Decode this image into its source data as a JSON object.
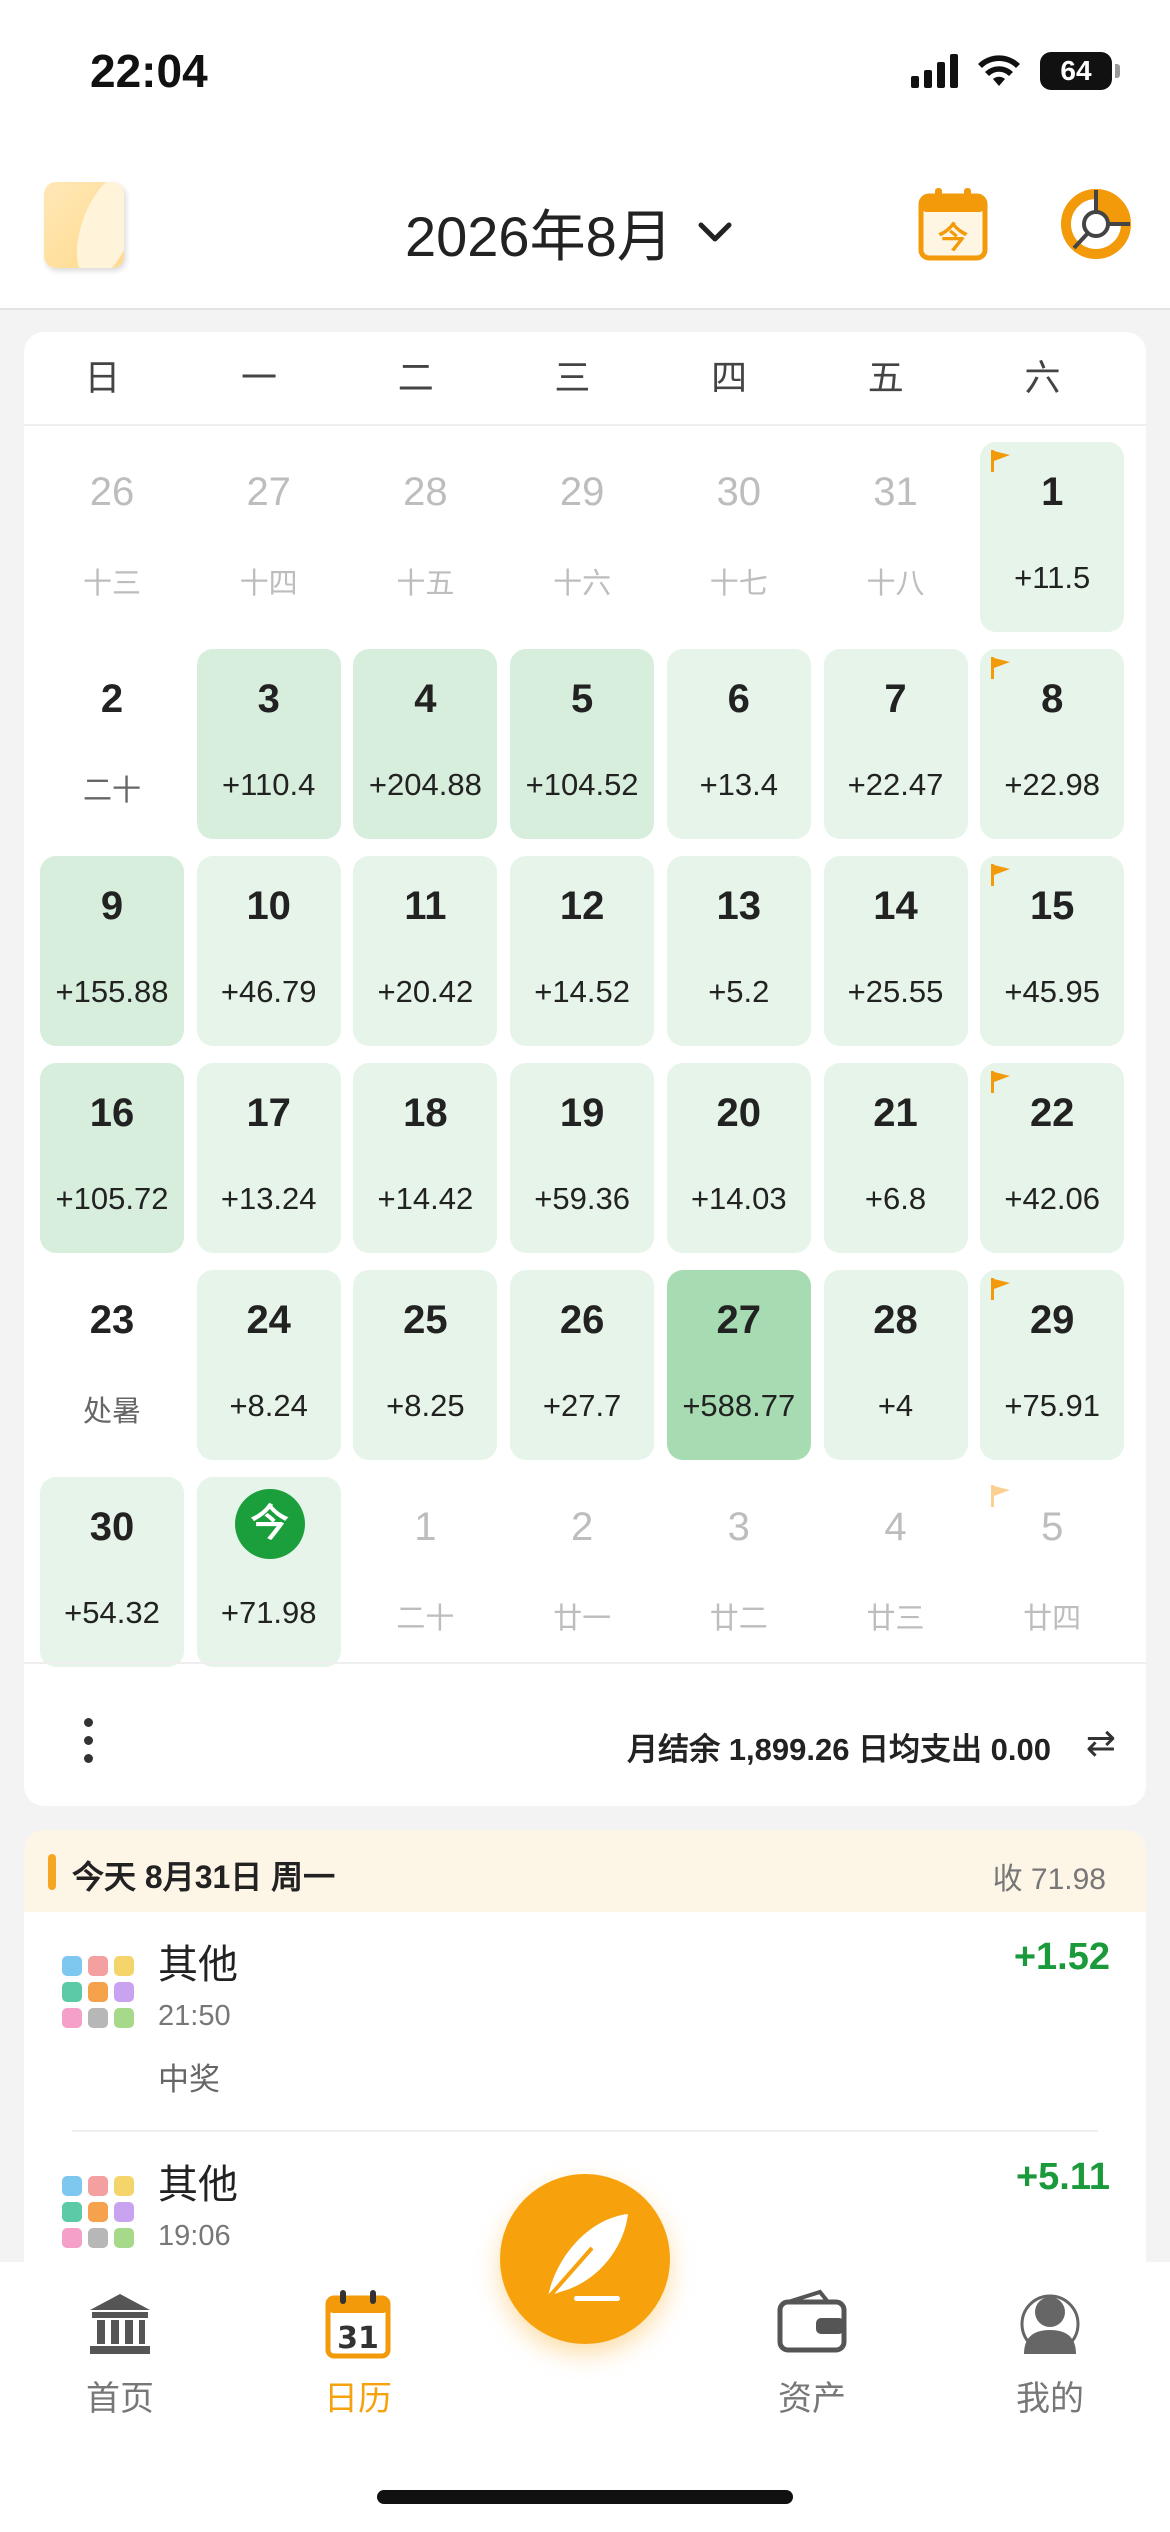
{
  "status": {
    "time": "22:04",
    "battery": "64"
  },
  "header": {
    "month_title": "2026年8月",
    "today_glyph": "今"
  },
  "weekdays": [
    "日",
    "一",
    "二",
    "三",
    "四",
    "五",
    "六"
  ],
  "calendar": [
    {
      "day": "26",
      "sub": "十三",
      "style": "muted",
      "sub_type": "lunar"
    },
    {
      "day": "27",
      "sub": "十四",
      "style": "muted",
      "sub_type": "lunar"
    },
    {
      "day": "28",
      "sub": "十五",
      "style": "muted",
      "sub_type": "lunar"
    },
    {
      "day": "29",
      "sub": "十六",
      "style": "muted",
      "sub_type": "lunar"
    },
    {
      "day": "30",
      "sub": "十七",
      "style": "muted",
      "sub_type": "lunar"
    },
    {
      "day": "31",
      "sub": "十八",
      "style": "muted",
      "sub_type": "lunar"
    },
    {
      "day": "1",
      "sub": "+11.5",
      "style": "c1",
      "flag": true
    },
    {
      "day": "2",
      "sub": "二十",
      "style": "none",
      "sub_type": "lunar"
    },
    {
      "day": "3",
      "sub": "+110.4",
      "style": "c2"
    },
    {
      "day": "4",
      "sub": "+204.88",
      "style": "c2"
    },
    {
      "day": "5",
      "sub": "+104.52",
      "style": "c2"
    },
    {
      "day": "6",
      "sub": "+13.4",
      "style": "c1"
    },
    {
      "day": "7",
      "sub": "+22.47",
      "style": "c1"
    },
    {
      "day": "8",
      "sub": "+22.98",
      "style": "c1",
      "flag": true
    },
    {
      "day": "9",
      "sub": "+155.88",
      "style": "c2"
    },
    {
      "day": "10",
      "sub": "+46.79",
      "style": "c1"
    },
    {
      "day": "11",
      "sub": "+20.42",
      "style": "c1"
    },
    {
      "day": "12",
      "sub": "+14.52",
      "style": "c1"
    },
    {
      "day": "13",
      "sub": "+5.2",
      "style": "c1"
    },
    {
      "day": "14",
      "sub": "+25.55",
      "style": "c1"
    },
    {
      "day": "15",
      "sub": "+45.95",
      "style": "c1",
      "flag": true
    },
    {
      "day": "16",
      "sub": "+105.72",
      "style": "c2"
    },
    {
      "day": "17",
      "sub": "+13.24",
      "style": "c1"
    },
    {
      "day": "18",
      "sub": "+14.42",
      "style": "c1"
    },
    {
      "day": "19",
      "sub": "+59.36",
      "style": "c1"
    },
    {
      "day": "20",
      "sub": "+14.03",
      "style": "c1"
    },
    {
      "day": "21",
      "sub": "+6.8",
      "style": "c1"
    },
    {
      "day": "22",
      "sub": "+42.06",
      "style": "c1",
      "flag": true
    },
    {
      "day": "23",
      "sub": "处暑",
      "style": "none",
      "sub_type": "lunar"
    },
    {
      "day": "24",
      "sub": "+8.24",
      "style": "c1"
    },
    {
      "day": "25",
      "sub": "+8.25",
      "style": "c1"
    },
    {
      "day": "26",
      "sub": "+27.7",
      "style": "c1"
    },
    {
      "day": "27",
      "sub": "+588.77",
      "style": "c3"
    },
    {
      "day": "28",
      "sub": "+4",
      "style": "c1"
    },
    {
      "day": "29",
      "sub": "+75.91",
      "style": "c1",
      "flag": true
    },
    {
      "day": "30",
      "sub": "+54.32",
      "style": "c1"
    },
    {
      "day": "今",
      "sub": "+71.98",
      "style": "c1",
      "today": true
    },
    {
      "day": "1",
      "sub": "二十",
      "style": "muted",
      "sub_type": "lunar"
    },
    {
      "day": "2",
      "sub": "廿一",
      "style": "muted",
      "sub_type": "lunar"
    },
    {
      "day": "3",
      "sub": "廿二",
      "style": "muted",
      "sub_type": "lunar"
    },
    {
      "day": "4",
      "sub": "廿三",
      "style": "muted",
      "sub_type": "lunar"
    },
    {
      "day": "5",
      "sub": "廿四",
      "style": "muted",
      "sub_type": "lunar",
      "flag": true
    }
  ],
  "summary": {
    "text": "月结余 1,899.26   日均支出 0.00",
    "swap_glyph": "⇄"
  },
  "day_section": {
    "label": "今天 8月31日 周一",
    "total": "收 71.98"
  },
  "transactions": [
    {
      "category": "其他",
      "time": "21:50",
      "note": "中奖",
      "amount": "+1.52"
    },
    {
      "category": "其他",
      "time": "19:06",
      "note": "",
      "amount": "+5.11"
    }
  ],
  "nav": [
    {
      "label": "首页",
      "icon": "bank-icon"
    },
    {
      "label": "日历",
      "icon": "calendar-icon",
      "active": true
    },
    {
      "label": "资产",
      "icon": "wallet-icon"
    },
    {
      "label": "我的",
      "icon": "profile-icon"
    }
  ],
  "colors": {
    "accent": "#f7a10c",
    "income": "#1a9a3a",
    "cell_light": "#e6f4e9",
    "cell_mid": "#d6eedb",
    "cell_strong": "#a7dcb2",
    "today": "#1b9e3c"
  }
}
